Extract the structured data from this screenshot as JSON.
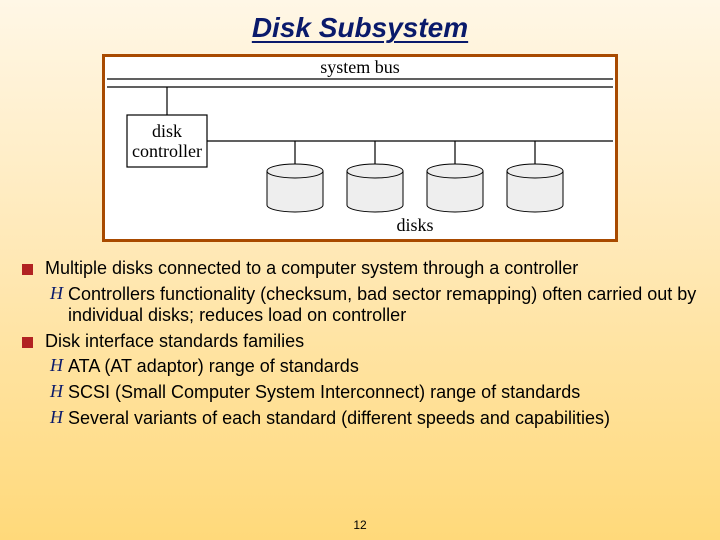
{
  "title": "Disk Subsystem",
  "diagram": {
    "system_bus_label": "system bus",
    "disk_controller_line1": "disk",
    "disk_controller_line2": "controller",
    "disks_label": "disks"
  },
  "bullets": {
    "p1": {
      "text": "Multiple disks connected to a computer system through a controller",
      "sub": [
        "Controllers functionality (checksum, bad sector remapping) often carried out by individual disks; reduces load on controller"
      ]
    },
    "p2": {
      "text": "Disk interface standards families",
      "sub": [
        "ATA (AT adaptor) range of standards",
        "SCSI (Small Computer System Interconnect) range of standards",
        "Several variants of each standard (different speeds and capabilities)"
      ]
    }
  },
  "page_number": "12"
}
